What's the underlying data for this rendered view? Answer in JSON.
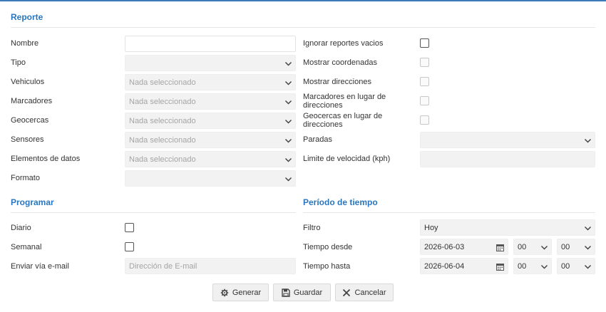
{
  "sections": {
    "report": "Reporte",
    "schedule": "Programar",
    "period": "Período de tiempo"
  },
  "left": {
    "name_label": "Nombre",
    "name_value": "",
    "type_label": "Tipo",
    "type_value": "",
    "vehicles_label": "Vehiculos",
    "vehicles_value": "Nada seleccionado",
    "markers_label": "Marcadores",
    "markers_value": "Nada seleccionado",
    "geofences_label": "Geocercas",
    "geofences_value": "Nada seleccionado",
    "sensors_label": "Sensores",
    "sensors_value": "Nada seleccionado",
    "data_items_label": "Elementos de datos",
    "data_items_value": "Nada seleccionado",
    "format_label": "Formato",
    "format_value": ""
  },
  "right": {
    "ignore_empty_label": "Ignorar reportes vacios",
    "ignore_empty_checked": false,
    "show_coords_label": "Mostrar coordenadas",
    "show_coords_checked": false,
    "show_addresses_label": "Mostrar direcciones",
    "show_addresses_checked": false,
    "markers_instead_label": "Marcadores en lugar de direcciones",
    "markers_instead_checked": false,
    "geofences_instead_label": "Geocercas en lugar de direcciones",
    "geofences_instead_checked": false,
    "stops_label": "Paradas",
    "stops_value": "",
    "speed_limit_label": "Limite de velocidad (kph)",
    "speed_limit_value": ""
  },
  "schedule": {
    "daily_label": "Diario",
    "daily_checked": false,
    "weekly_label": "Semanal",
    "weekly_checked": false,
    "email_label": "Enviar vía e-mail",
    "email_placeholder": "Dirección de E-mail",
    "email_value": ""
  },
  "period": {
    "filter_label": "Filtro",
    "filter_value": "Hoy",
    "from_label": "Tiempo desde",
    "from_date": "2026-06-03",
    "from_hour": "00",
    "from_minute": "00",
    "to_label": "Tiempo hasta",
    "to_date": "2026-06-04",
    "to_hour": "00",
    "to_minute": "00"
  },
  "buttons": {
    "generate": "Generar",
    "save": "Guardar",
    "cancel": "Cancelar"
  },
  "icons": {
    "select": "chevron-down-icon",
    "date": "calendar-icon",
    "generate": "cog-icon",
    "save": "floppy-icon",
    "cancel": "close-icon"
  },
  "colors": {
    "accent": "#2a77bf",
    "disabled_field": "#f2f2f2",
    "placeholder": "#a5a5a5"
  }
}
